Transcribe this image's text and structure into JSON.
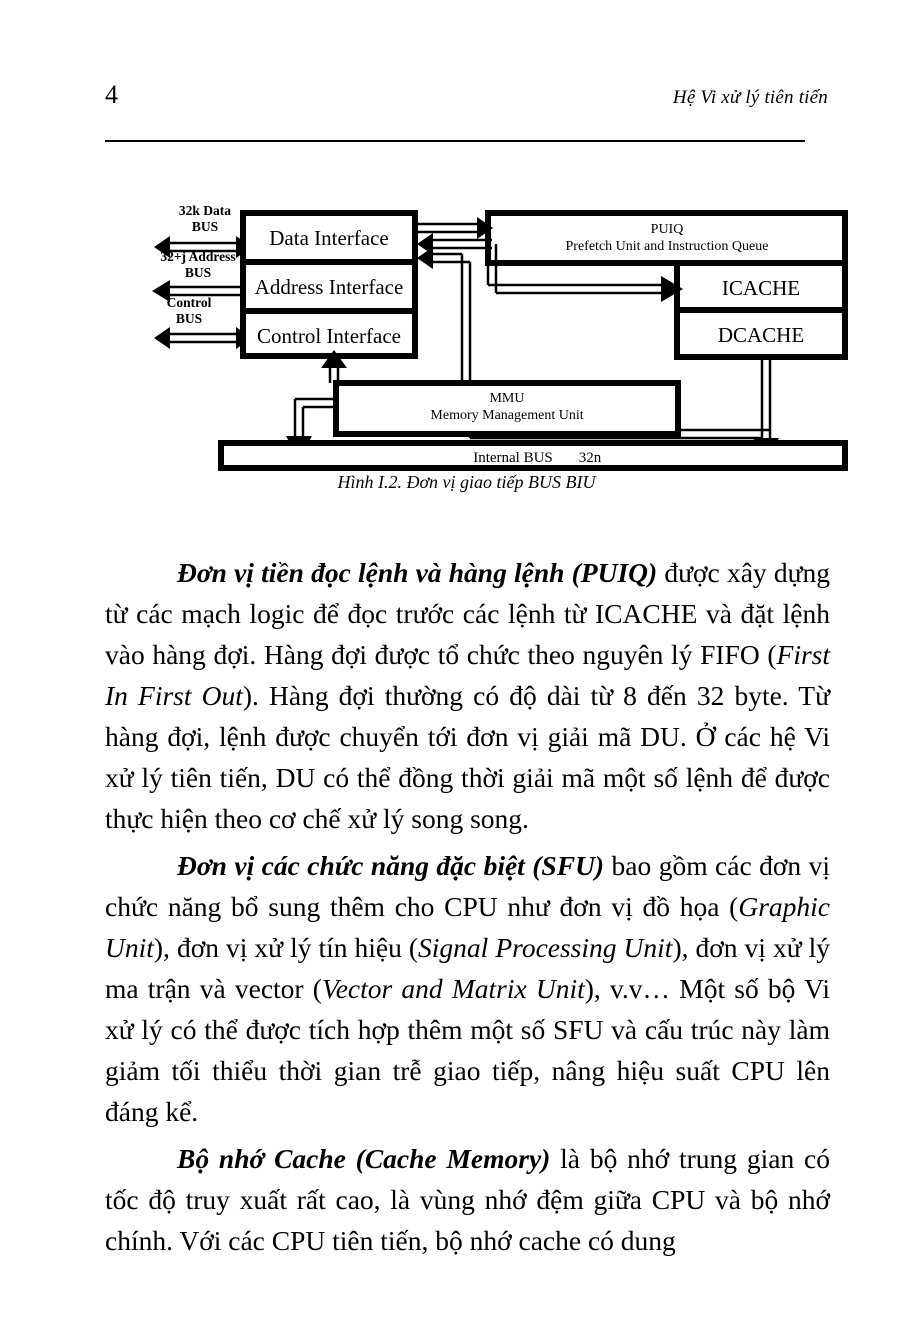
{
  "header": {
    "page_number": "4",
    "running_title": "Hệ Vi xử lý tiên tiến"
  },
  "figure": {
    "caption": "Hình I.2. Đơn vị giao tiếp BUS BIU",
    "external_bus_labels": [
      {
        "line1": "32k Data",
        "line2": "BUS"
      },
      {
        "line1": "32+j Address",
        "line2": "BUS"
      },
      {
        "line1": "Control",
        "line2": "BUS"
      }
    ],
    "blocks": {
      "data_interface": "Data Interface",
      "address_interface": "Address Interface",
      "control_interface": "Control Interface",
      "puiq_title": "PUIQ",
      "puiq_subtitle": "Prefetch Unit and Instruction Queue",
      "icache": "ICACHE",
      "dcache": "DCACHE",
      "mmu_title": "MMU",
      "mmu_subtitle": "Memory Management Unit",
      "internal_bus": "Internal BUS",
      "internal_bus_width": "32n"
    }
  },
  "body": {
    "paragraph_1": {
      "lead": "Đơn vị tiền đọc lệnh và hàng lệnh (PUIQ)",
      "text_a": " được xây dựng từ các mạch logic để đọc trước các lệnh từ ICACHE và đặt lệnh vào hàng đợi. Hàng đợi được tổ chức theo nguyên lý FIFO (",
      "italic_a": "First In First Out",
      "text_b": "). Hàng đợi thường có độ dài từ 8 đến 32 byte. Từ hàng đợi, lệnh được chuyển tới đơn vị giải mã DU. Ở các hệ Vi xử lý tiên tiến, DU có thể đồng thời giải mã một số lệnh để được thực hiện theo cơ chế xử lý song song."
    },
    "paragraph_2": {
      "lead": "Đơn vị các chức năng đặc biệt (SFU)",
      "text_a": " bao gồm các đơn vị chức năng bổ sung thêm cho CPU như đơn vị đồ họa (",
      "italic_a": "Graphic Unit",
      "text_b": "), đơn vị xử lý tín hiệu (",
      "italic_b": "Signal Processing Unit",
      "text_c": "), đơn vị xử lý ma trận và vector (",
      "italic_c": "Vector and Matrix Unit",
      "text_d": "), v.v… Một số bộ Vi xử lý có thể được tích hợp thêm một số SFU và cấu trúc này làm giảm tối thiểu thời gian trễ giao tiếp, nâng hiệu suất CPU lên đáng kể."
    },
    "paragraph_3": {
      "lead": "Bộ nhớ Cache (",
      "lead_italic": "Cache Memory",
      "lead_tail": ")",
      "text_a": " là bộ nhớ trung gian có tốc độ truy xuất rất cao, là vùng nhớ đệm giữa CPU và bộ nhớ chính. Với các CPU tiên tiến, bộ nhớ cache có dung"
    }
  }
}
